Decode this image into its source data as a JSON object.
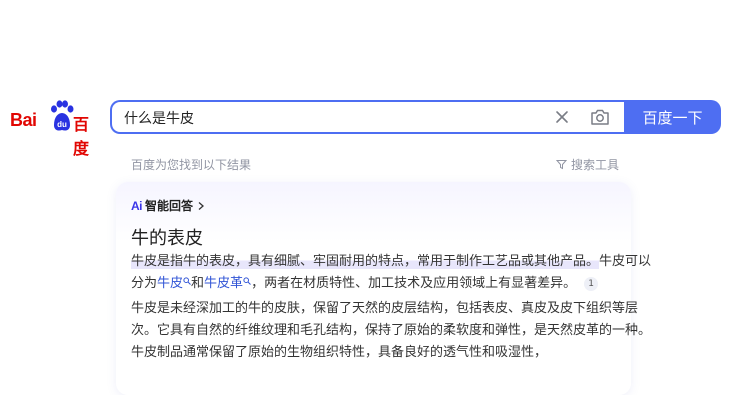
{
  "logo": {
    "bai": "Bai",
    "du_in_paw": "du",
    "baidu_cn": "百度"
  },
  "search": {
    "query": "什么是牛皮",
    "button_label": "百度一下"
  },
  "results_bar": {
    "stats_text": "百度为您找到以下结果",
    "tools_label": "搜索工具"
  },
  "ai_answer": {
    "brand": "Ai",
    "header_label": "智能回答",
    "title": "牛的表皮",
    "p1_line1_highlight": "牛皮是指牛的表皮，具有细腻、牢固耐用的特点，常用于制作工艺品或其他产品。",
    "p1_line1_rest": "牛皮可以",
    "p1_line2_prefix": "分为",
    "link1": "牛皮",
    "p1_line2_mid": "和",
    "link2": "牛皮革",
    "p1_line2_suffix": "，两者在材质特性、加工技术及应用领域上有显著差异。",
    "citation": "1",
    "p2_line1": "牛皮是未经深加工的牛的皮肤，保留了天然的皮层结构，包括表皮、真皮及皮下组织等层",
    "p2_line2": "次。它具有自然的纤维纹理和毛孔结构，保持了原始的柔软度和弹性，是天然皮革的一种。",
    "p2_line3": "牛皮制品通常保留了原始的生物组织特性，具备良好的透气性和吸湿性，"
  },
  "colors": {
    "accent": "#4e6ef2",
    "brand_red": "#e10602",
    "ai_purple": "#3b35e8",
    "link": "#3155d6"
  }
}
